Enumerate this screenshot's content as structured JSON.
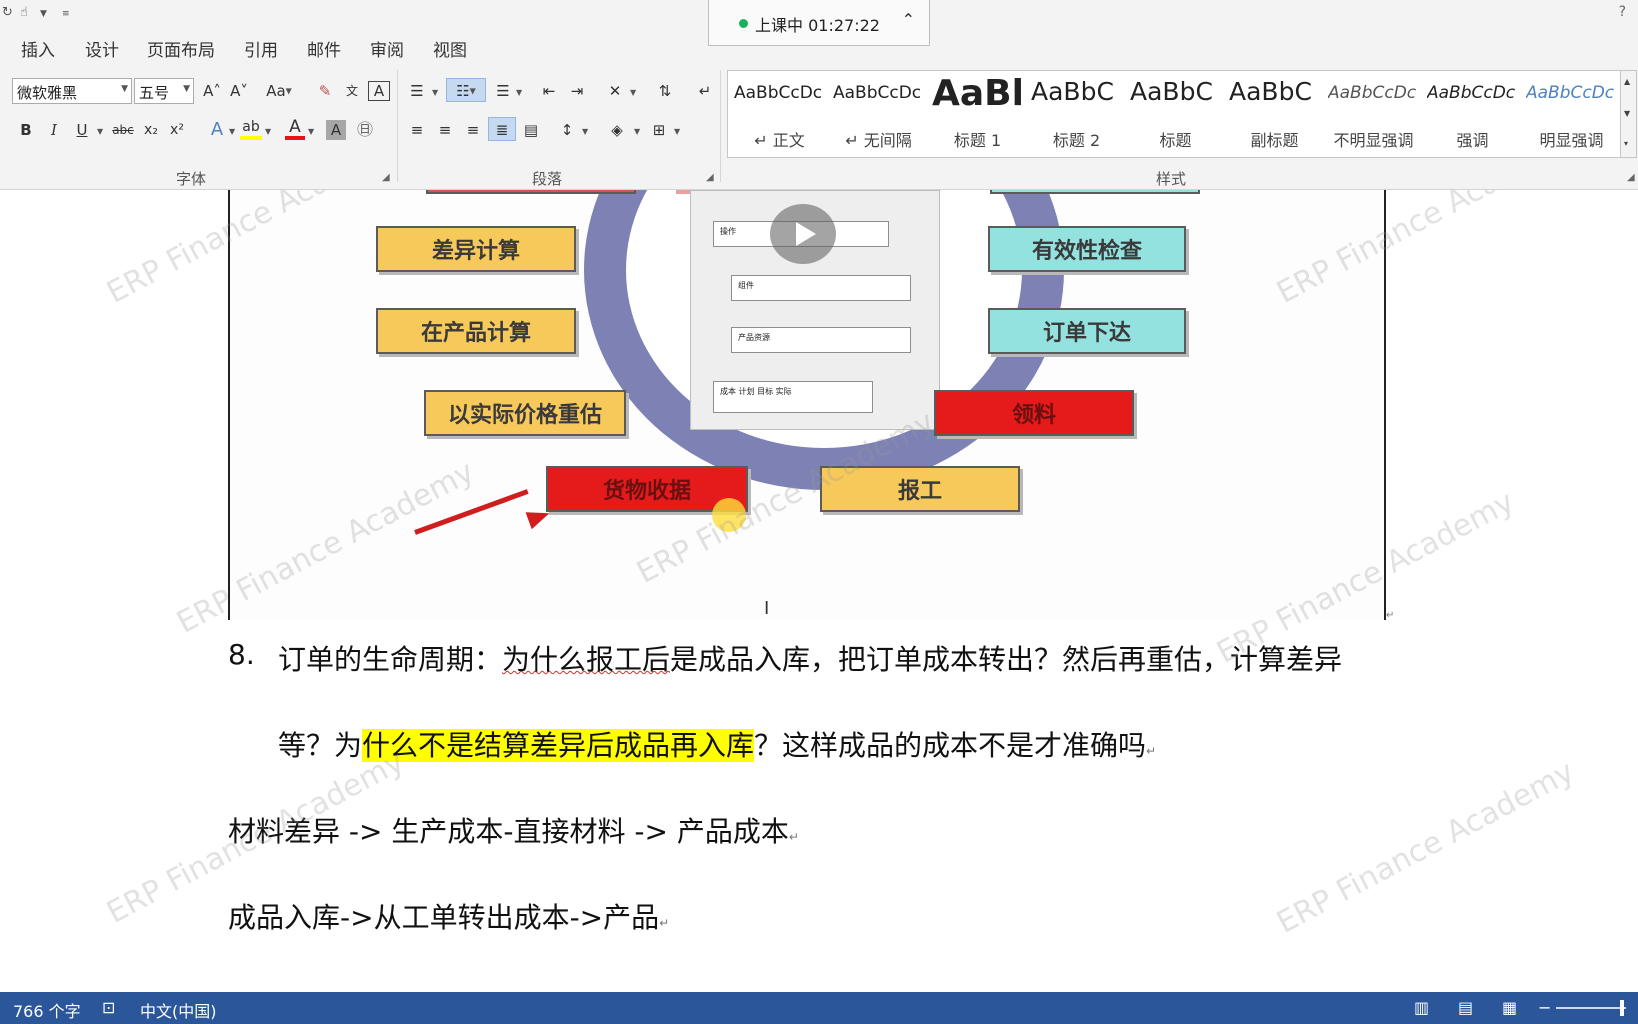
{
  "live_bar": {
    "status_text": "上课中 01:27:22"
  },
  "tabs": [
    "插入",
    "设计",
    "页面布局",
    "引用",
    "邮件",
    "审阅",
    "视图"
  ],
  "font_group": {
    "font_name": "微软雅黑",
    "font_size": "五号",
    "label": "字体",
    "grow_font": "A˄",
    "shrink_font": "A˅",
    "change_case": "Aa",
    "bold": "B",
    "italic": "I",
    "underline": "U",
    "strikethrough": "abc",
    "subscript": "x₂",
    "superscript": "x²",
    "text_effects": "A",
    "font_color": "A",
    "char_shading": "A",
    "enclose": "㊐"
  },
  "paragraph_group": {
    "label": "段落"
  },
  "styles_group": {
    "label": "样式",
    "items": [
      {
        "sample": "AaBbCcDc",
        "label": "↵ 正文"
      },
      {
        "sample": "AaBbCcDc",
        "label": "↵ 无间隔"
      },
      {
        "sample": "AaBl",
        "label": "标题 1"
      },
      {
        "sample": "AaBbC",
        "label": "标题 2"
      },
      {
        "sample": "AaBbC",
        "label": "标题"
      },
      {
        "sample": "AaBbC",
        "label": "副标题"
      },
      {
        "sample": "AaBbCcDc",
        "label": "不明显强调"
      },
      {
        "sample": "AaBbCcDc",
        "label": "强调"
      },
      {
        "sample": "AaBbCcDc",
        "label": "明显强调"
      }
    ]
  },
  "figure": {
    "nodes": {
      "diff_calc": "差异计算",
      "wip_calc": "在产品计算",
      "revalue": "以实际价格重估",
      "goods_receipt": "货物收据",
      "confirmation": "报工",
      "material_issue": "领料",
      "order_release": "订单下达",
      "availability_check": "有效性检查"
    },
    "screen_rows": [
      "操作",
      "组件",
      "产品资源",
      "成本  计划 目标 实际"
    ]
  },
  "document": {
    "para8_number": "8.",
    "para8_line1_a": "订单的生命周期：",
    "para8_line1_b": "为什么报工后",
    "para8_line1_c": "是成品入库，把订单成本转出？然后再重估，计算差异",
    "para8_line2_a": "等？为",
    "para8_line2_hl": "什么不是结算差异后成品再入库",
    "para8_line2_b": "？这样成品的成本不是才准确吗",
    "line_material": "材料差异  ->  生产成本-直接材料  ->  产品成本",
    "line_receipt": "成品入库->从工单转出成本->产品",
    "para_mark": "↵"
  },
  "watermark_text": "ERP Finance Academy",
  "status_bar": {
    "word_count": "766 个字",
    "language": "中文(中国)"
  },
  "colors": {
    "status_bar": "#2b579a",
    "highlight": "#ffff00",
    "node_yellow": "#f7c95a",
    "node_cyan": "#93e2df",
    "node_red": "#e51b1b",
    "ring": "#7e81b4"
  }
}
